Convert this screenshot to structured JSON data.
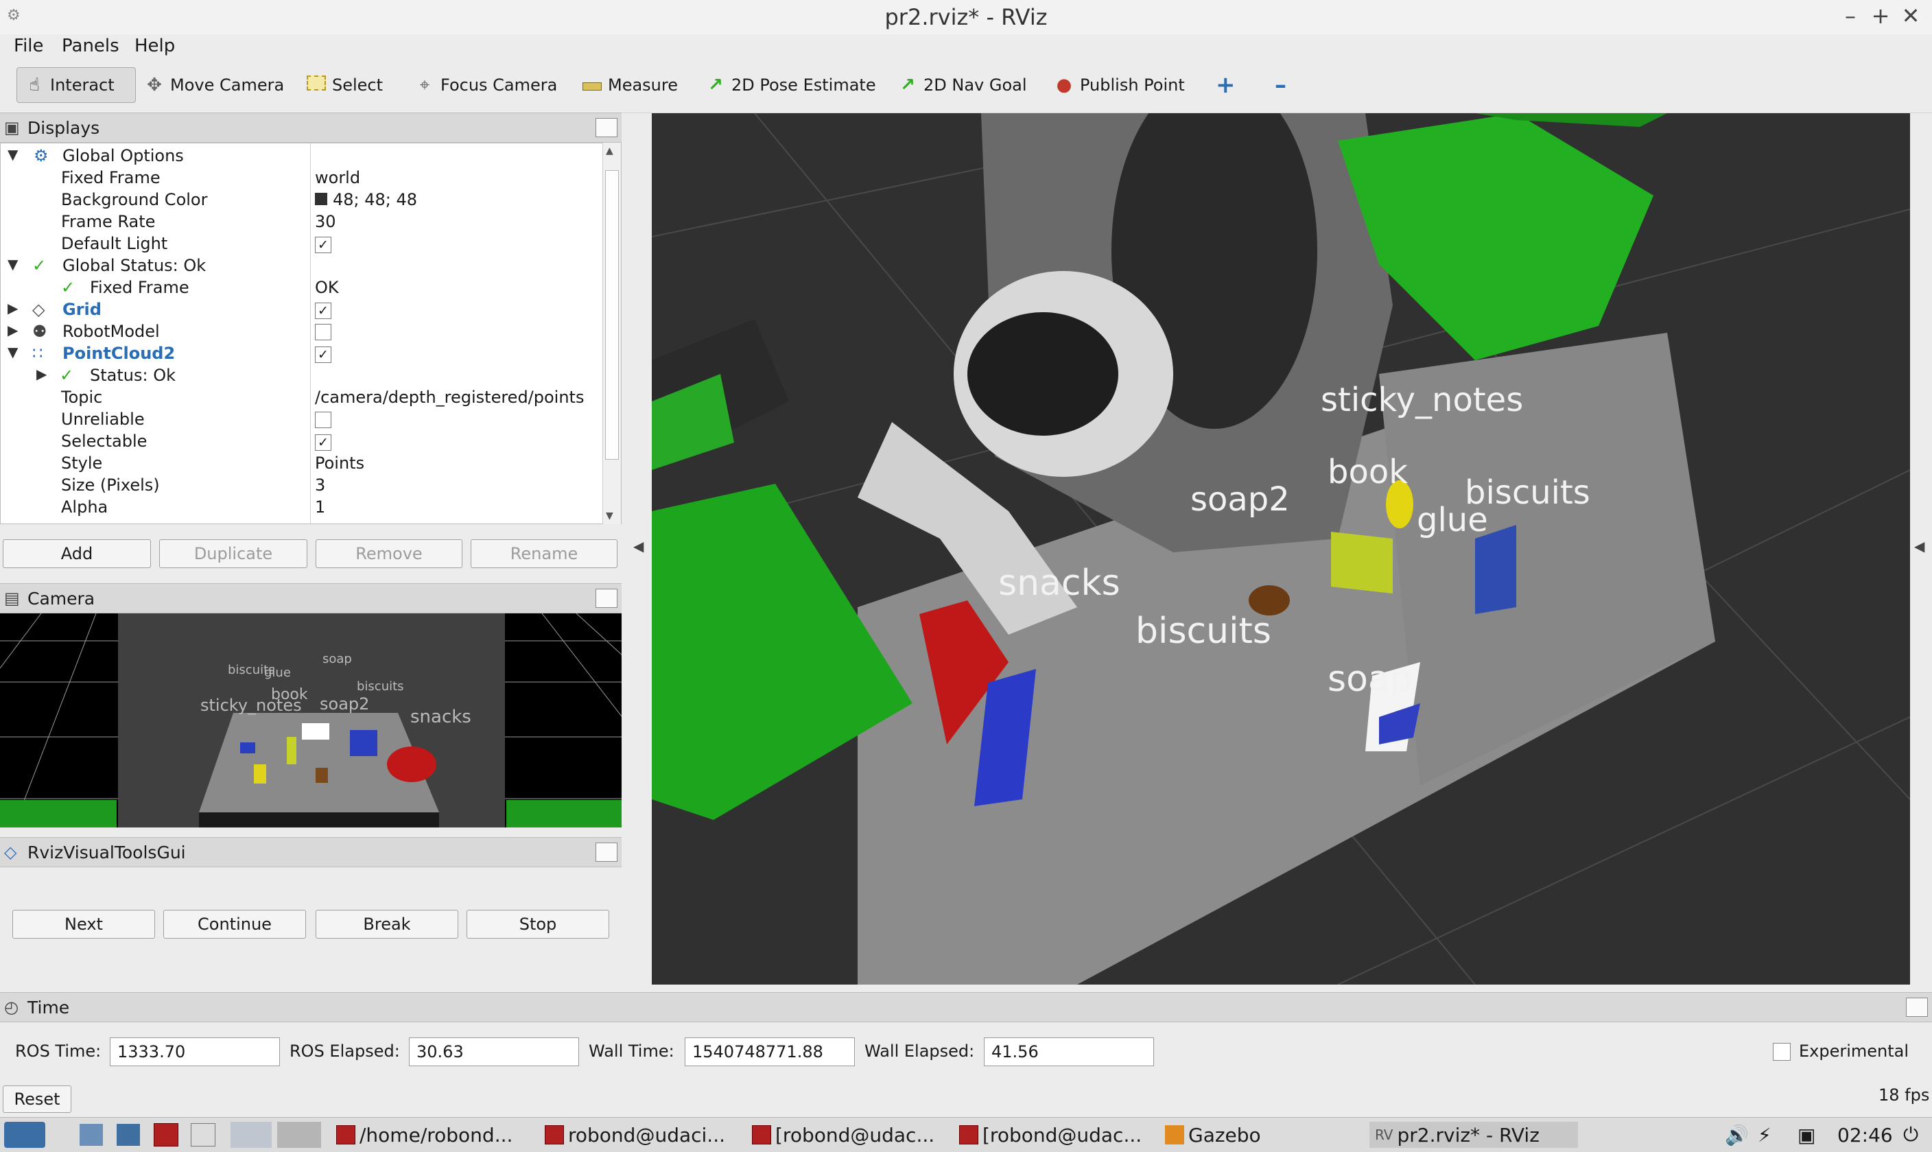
{
  "window": {
    "title": "pr2.rviz* - RViz"
  },
  "menu": [
    "File",
    "Panels",
    "Help"
  ],
  "toolbar": {
    "interact": "Interact",
    "move_camera": "Move Camera",
    "select": "Select",
    "focus_camera": "Focus Camera",
    "measure": "Measure",
    "pose_estimate": "2D Pose Estimate",
    "nav_goal": "2D Nav Goal",
    "publish_point": "Publish Point"
  },
  "displays": {
    "title": "Displays",
    "rows": [
      {
        "name": "Global Options",
        "value": ""
      },
      {
        "name": "Fixed Frame",
        "value": "world"
      },
      {
        "name": "Background Color",
        "value": "48; 48; 48"
      },
      {
        "name": "Frame Rate",
        "value": "30"
      },
      {
        "name": "Default Light",
        "value": ""
      },
      {
        "name": "Global Status: Ok",
        "value": ""
      },
      {
        "name": "Fixed Frame",
        "value": "OK"
      },
      {
        "name": "Grid",
        "value": ""
      },
      {
        "name": "RobotModel",
        "value": ""
      },
      {
        "name": "PointCloud2",
        "value": ""
      },
      {
        "name": "Status: Ok",
        "value": ""
      },
      {
        "name": "Topic",
        "value": "/camera/depth_registered/points"
      },
      {
        "name": "Unreliable",
        "value": ""
      },
      {
        "name": "Selectable",
        "value": ""
      },
      {
        "name": "Style",
        "value": "Points"
      },
      {
        "name": "Size (Pixels)",
        "value": "3"
      },
      {
        "name": "Alpha",
        "value": "1"
      }
    ],
    "buttons": {
      "add": "Add",
      "duplicate": "Duplicate",
      "remove": "Remove",
      "rename": "Rename"
    }
  },
  "camera": {
    "title": "Camera",
    "labels": {
      "biscuits1": "biscuits",
      "glue": "glue",
      "soap": "soap",
      "biscuits2": "biscuits",
      "sticky_notes": "sticky_notes",
      "book": "book",
      "soap2": "soap2",
      "snacks": "snacks"
    }
  },
  "rviz_tools": {
    "title": "RvizVisualToolsGui",
    "buttons": {
      "next": "Next",
      "continue": "Continue",
      "break": "Break",
      "stop": "Stop"
    }
  },
  "scene_labels": {
    "sticky_notes": "sticky_notes",
    "book": "book",
    "soap2": "soap2",
    "biscuits_right": "biscuits",
    "glue": "glue",
    "snacks": "snacks",
    "biscuits_center": "biscuits",
    "soap": "soap"
  },
  "time": {
    "title": "Time",
    "ros_time_label": "ROS Time:",
    "ros_time": "1333.70",
    "ros_elapsed_label": "ROS Elapsed:",
    "ros_elapsed": "30.63",
    "wall_time_label": "Wall Time:",
    "wall_time": "1540748771.88",
    "wall_elapsed_label": "Wall Elapsed:",
    "wall_elapsed": "41.56",
    "experimental": "Experimental",
    "reset": "Reset",
    "fps": "18 fps"
  },
  "taskbar": {
    "tasks": [
      "/home/robond...",
      "robond@udaci...",
      "[robond@udac...",
      "[robond@udac...",
      "Gazebo",
      "pr2.rviz* - RViz"
    ],
    "clock": "02:46"
  }
}
